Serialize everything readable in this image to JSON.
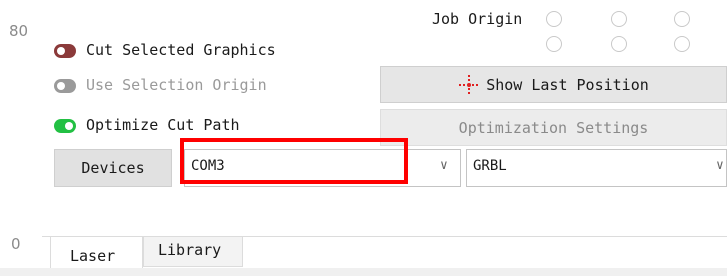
{
  "ruler": {
    "top_value": "80",
    "bottom_value": "0"
  },
  "job_origin": {
    "label": "Job Origin"
  },
  "options": [
    {
      "label": "Cut Selected Graphics",
      "state": "off",
      "color": "#8b3a3a",
      "enabled": true
    },
    {
      "label": "Use Selection Origin",
      "state": "off",
      "color": "#9a9a9a",
      "enabled": false
    },
    {
      "label": "Optimize Cut Path",
      "state": "on",
      "color": "#22c043",
      "enabled": true
    }
  ],
  "buttons": {
    "show_last_position": "Show Last Position",
    "optimization_settings": "Optimization Settings",
    "devices": "Devices"
  },
  "port_select": {
    "value": "COM3"
  },
  "device_select": {
    "value": "GRBL"
  },
  "tabs": [
    {
      "label": "Laser",
      "active": true
    },
    {
      "label": "Library",
      "active": false
    }
  ],
  "highlight_color": "#ff0000"
}
